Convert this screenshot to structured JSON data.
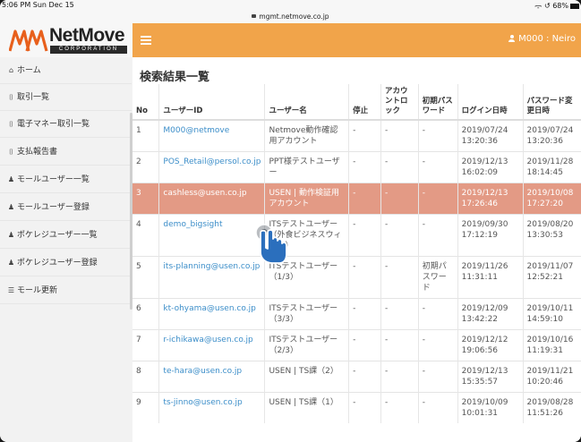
{
  "status_bar": {
    "time": "5:06 PM  Sun Dec 15",
    "url": "mgmt.netmove.co.jp",
    "indicators": "ᯙ ↺ 68%"
  },
  "brand": {
    "name": "NetMove",
    "tagline": "CORPORATION",
    "logo_color": "#e8601c"
  },
  "header": {
    "accent": "#f1a44a",
    "user_label": "M000 : Neiro"
  },
  "sidebar": {
    "items": [
      {
        "icon": "home-icon",
        "glyph": "⌂",
        "label": "ホーム"
      },
      {
        "icon": "document-icon",
        "glyph": "⌷",
        "label": "取引一覧"
      },
      {
        "icon": "document-icon",
        "glyph": "⌷",
        "label": "電子マネー取引一覧"
      },
      {
        "icon": "document-icon",
        "glyph": "⌷",
        "label": "支払報告書"
      },
      {
        "icon": "user-icon",
        "glyph": "♟",
        "label": "モールユーザー一覧"
      },
      {
        "icon": "user-icon",
        "glyph": "♟",
        "label": "モールユーザー登録"
      },
      {
        "icon": "users-icon",
        "glyph": "♟",
        "label": "ポケレジユーザー一覧"
      },
      {
        "icon": "users-icon",
        "glyph": "♟",
        "label": "ポケレジユーザー登録"
      },
      {
        "icon": "cart-icon",
        "glyph": "☰",
        "label": "モール更新"
      }
    ]
  },
  "main": {
    "title": "検索結果一覧",
    "columns": [
      "No",
      "ユーザーID",
      "ユーザー名",
      "停止",
      "アカウントロック",
      "初期パスワード",
      "ログイン日時",
      "パスワード変更日時"
    ],
    "highlight_color": "#e39a85",
    "rows": [
      {
        "no": "1",
        "user_id": "M000@netmove",
        "user_name": "Netmove動作確認用アカウント",
        "stopped": "-",
        "locked": "-",
        "initial_pw": "-",
        "login": "2019/07/24 13:20:36",
        "pw_changed": "2019/07/24 13:20:36"
      },
      {
        "no": "2",
        "user_id": "POS_Retail@persol.co.jp",
        "user_name": "PPT様テストユーザー",
        "stopped": "-",
        "locked": "-",
        "initial_pw": "-",
        "login": "2019/12/13 16:02:09",
        "pw_changed": "2019/11/28 18:14:45"
      },
      {
        "no": "3",
        "user_id": "cashless@usen.co.jp",
        "user_name": "USEN | 動作検証用アカウント",
        "stopped": "-",
        "locked": "-",
        "initial_pw": "-",
        "login": "2019/12/13 17:26:46",
        "pw_changed": "2019/10/08 17:27:20"
      },
      {
        "no": "4",
        "user_id": "demo_bigsight",
        "user_name": "ITSテストユーザー（外食ビジネスウィーク）",
        "stopped": "-",
        "locked": "-",
        "initial_pw": "-",
        "login": "2019/09/30 17:12:19",
        "pw_changed": "2019/08/20 13:30:53"
      },
      {
        "no": "5",
        "user_id": "its-planning@usen.co.jp",
        "user_name": "ITSテストユーザー（1/3）",
        "stopped": "-",
        "locked": "-",
        "initial_pw": "初期パスワード",
        "login": "2019/11/26 11:31:11",
        "pw_changed": "2019/11/07 12:52:21"
      },
      {
        "no": "6",
        "user_id": "kt-ohyama@usen.co.jp",
        "user_name": "ITSテストユーザー（3/3）",
        "stopped": "-",
        "locked": "-",
        "initial_pw": "-",
        "login": "2019/12/09 13:42:22",
        "pw_changed": "2019/10/11 14:59:10"
      },
      {
        "no": "7",
        "user_id": "r-ichikawa@usen.co.jp",
        "user_name": "ITSテストユーザー（2/3）",
        "stopped": "-",
        "locked": "-",
        "initial_pw": "-",
        "login": "2019/12/12 19:06:56",
        "pw_changed": "2019/10/16 11:19:31"
      },
      {
        "no": "8",
        "user_id": "te-hara@usen.co.jp",
        "user_name": "USEN | TS課（2）",
        "stopped": "-",
        "locked": "-",
        "initial_pw": "-",
        "login": "2019/12/13 15:35:57",
        "pw_changed": "2019/11/21 10:20:46"
      },
      {
        "no": "9",
        "user_id": "ts-jinno@usen.co.jp",
        "user_name": "USEN | TS課（1）",
        "stopped": "-",
        "locked": "-",
        "initial_pw": "-",
        "login": "2019/10/09 10:01:31",
        "pw_changed": "2019/08/28 11:51:26"
      }
    ]
  }
}
